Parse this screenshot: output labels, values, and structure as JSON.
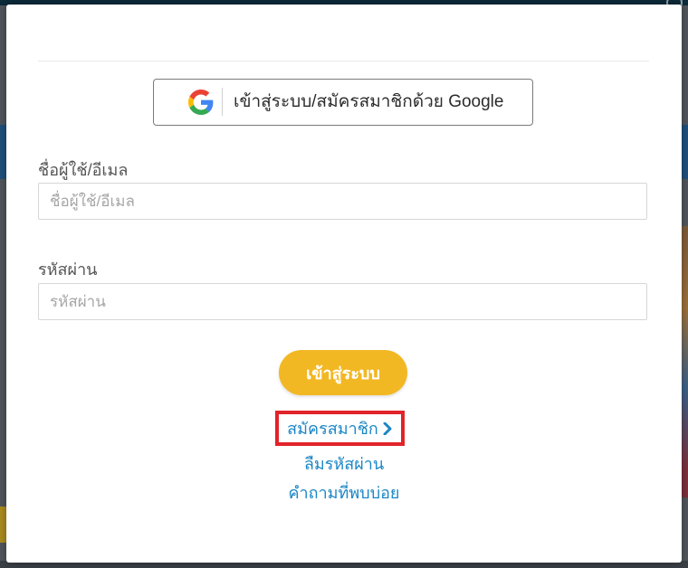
{
  "dialog": {
    "google_button_label": "เข้าสู่ระบบ/สมัครสมาชิกด้วย Google",
    "username": {
      "label": "ชื่อผู้ใช้/อีเมล",
      "placeholder": "ชื่อผู้ใช้/อีเมล",
      "value": ""
    },
    "password": {
      "label": "รหัสผ่าน",
      "placeholder": "รหัสผ่าน",
      "value": ""
    },
    "login_button_label": "เข้าสู่ระบบ",
    "register_link": "สมัครสมาชิก",
    "forgot_password_link": "ลืมรหัสผ่าน",
    "faq_link": "คำถามที่พบบ่อย"
  },
  "icons": {
    "google": "google-g-icon",
    "register_chevron": "chevron-right-icon",
    "close": "close-icon"
  },
  "colors": {
    "accent_yellow": "#f2b824",
    "link_blue": "#1b86c6",
    "highlight_red": "#e2232a"
  }
}
